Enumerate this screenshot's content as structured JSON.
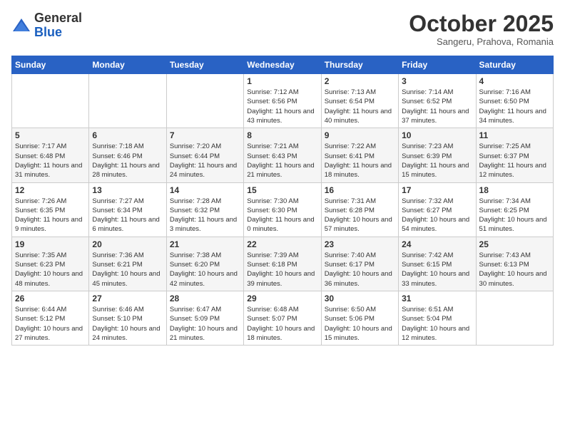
{
  "logo": {
    "general": "General",
    "blue": "Blue"
  },
  "title": "October 2025",
  "subtitle": "Sangeru, Prahova, Romania",
  "days_header": [
    "Sunday",
    "Monday",
    "Tuesday",
    "Wednesday",
    "Thursday",
    "Friday",
    "Saturday"
  ],
  "weeks": [
    [
      {
        "day": "",
        "info": ""
      },
      {
        "day": "",
        "info": ""
      },
      {
        "day": "",
        "info": ""
      },
      {
        "day": "1",
        "info": "Sunrise: 7:12 AM\nSunset: 6:56 PM\nDaylight: 11 hours and 43 minutes."
      },
      {
        "day": "2",
        "info": "Sunrise: 7:13 AM\nSunset: 6:54 PM\nDaylight: 11 hours and 40 minutes."
      },
      {
        "day": "3",
        "info": "Sunrise: 7:14 AM\nSunset: 6:52 PM\nDaylight: 11 hours and 37 minutes."
      },
      {
        "day": "4",
        "info": "Sunrise: 7:16 AM\nSunset: 6:50 PM\nDaylight: 11 hours and 34 minutes."
      }
    ],
    [
      {
        "day": "5",
        "info": "Sunrise: 7:17 AM\nSunset: 6:48 PM\nDaylight: 11 hours and 31 minutes."
      },
      {
        "day": "6",
        "info": "Sunrise: 7:18 AM\nSunset: 6:46 PM\nDaylight: 11 hours and 28 minutes."
      },
      {
        "day": "7",
        "info": "Sunrise: 7:20 AM\nSunset: 6:44 PM\nDaylight: 11 hours and 24 minutes."
      },
      {
        "day": "8",
        "info": "Sunrise: 7:21 AM\nSunset: 6:43 PM\nDaylight: 11 hours and 21 minutes."
      },
      {
        "day": "9",
        "info": "Sunrise: 7:22 AM\nSunset: 6:41 PM\nDaylight: 11 hours and 18 minutes."
      },
      {
        "day": "10",
        "info": "Sunrise: 7:23 AM\nSunset: 6:39 PM\nDaylight: 11 hours and 15 minutes."
      },
      {
        "day": "11",
        "info": "Sunrise: 7:25 AM\nSunset: 6:37 PM\nDaylight: 11 hours and 12 minutes."
      }
    ],
    [
      {
        "day": "12",
        "info": "Sunrise: 7:26 AM\nSunset: 6:35 PM\nDaylight: 11 hours and 9 minutes."
      },
      {
        "day": "13",
        "info": "Sunrise: 7:27 AM\nSunset: 6:34 PM\nDaylight: 11 hours and 6 minutes."
      },
      {
        "day": "14",
        "info": "Sunrise: 7:28 AM\nSunset: 6:32 PM\nDaylight: 11 hours and 3 minutes."
      },
      {
        "day": "15",
        "info": "Sunrise: 7:30 AM\nSunset: 6:30 PM\nDaylight: 11 hours and 0 minutes."
      },
      {
        "day": "16",
        "info": "Sunrise: 7:31 AM\nSunset: 6:28 PM\nDaylight: 10 hours and 57 minutes."
      },
      {
        "day": "17",
        "info": "Sunrise: 7:32 AM\nSunset: 6:27 PM\nDaylight: 10 hours and 54 minutes."
      },
      {
        "day": "18",
        "info": "Sunrise: 7:34 AM\nSunset: 6:25 PM\nDaylight: 10 hours and 51 minutes."
      }
    ],
    [
      {
        "day": "19",
        "info": "Sunrise: 7:35 AM\nSunset: 6:23 PM\nDaylight: 10 hours and 48 minutes."
      },
      {
        "day": "20",
        "info": "Sunrise: 7:36 AM\nSunset: 6:21 PM\nDaylight: 10 hours and 45 minutes."
      },
      {
        "day": "21",
        "info": "Sunrise: 7:38 AM\nSunset: 6:20 PM\nDaylight: 10 hours and 42 minutes."
      },
      {
        "day": "22",
        "info": "Sunrise: 7:39 AM\nSunset: 6:18 PM\nDaylight: 10 hours and 39 minutes."
      },
      {
        "day": "23",
        "info": "Sunrise: 7:40 AM\nSunset: 6:17 PM\nDaylight: 10 hours and 36 minutes."
      },
      {
        "day": "24",
        "info": "Sunrise: 7:42 AM\nSunset: 6:15 PM\nDaylight: 10 hours and 33 minutes."
      },
      {
        "day": "25",
        "info": "Sunrise: 7:43 AM\nSunset: 6:13 PM\nDaylight: 10 hours and 30 minutes."
      }
    ],
    [
      {
        "day": "26",
        "info": "Sunrise: 6:44 AM\nSunset: 5:12 PM\nDaylight: 10 hours and 27 minutes."
      },
      {
        "day": "27",
        "info": "Sunrise: 6:46 AM\nSunset: 5:10 PM\nDaylight: 10 hours and 24 minutes."
      },
      {
        "day": "28",
        "info": "Sunrise: 6:47 AM\nSunset: 5:09 PM\nDaylight: 10 hours and 21 minutes."
      },
      {
        "day": "29",
        "info": "Sunrise: 6:48 AM\nSunset: 5:07 PM\nDaylight: 10 hours and 18 minutes."
      },
      {
        "day": "30",
        "info": "Sunrise: 6:50 AM\nSunset: 5:06 PM\nDaylight: 10 hours and 15 minutes."
      },
      {
        "day": "31",
        "info": "Sunrise: 6:51 AM\nSunset: 5:04 PM\nDaylight: 10 hours and 12 minutes."
      },
      {
        "day": "",
        "info": ""
      }
    ]
  ]
}
